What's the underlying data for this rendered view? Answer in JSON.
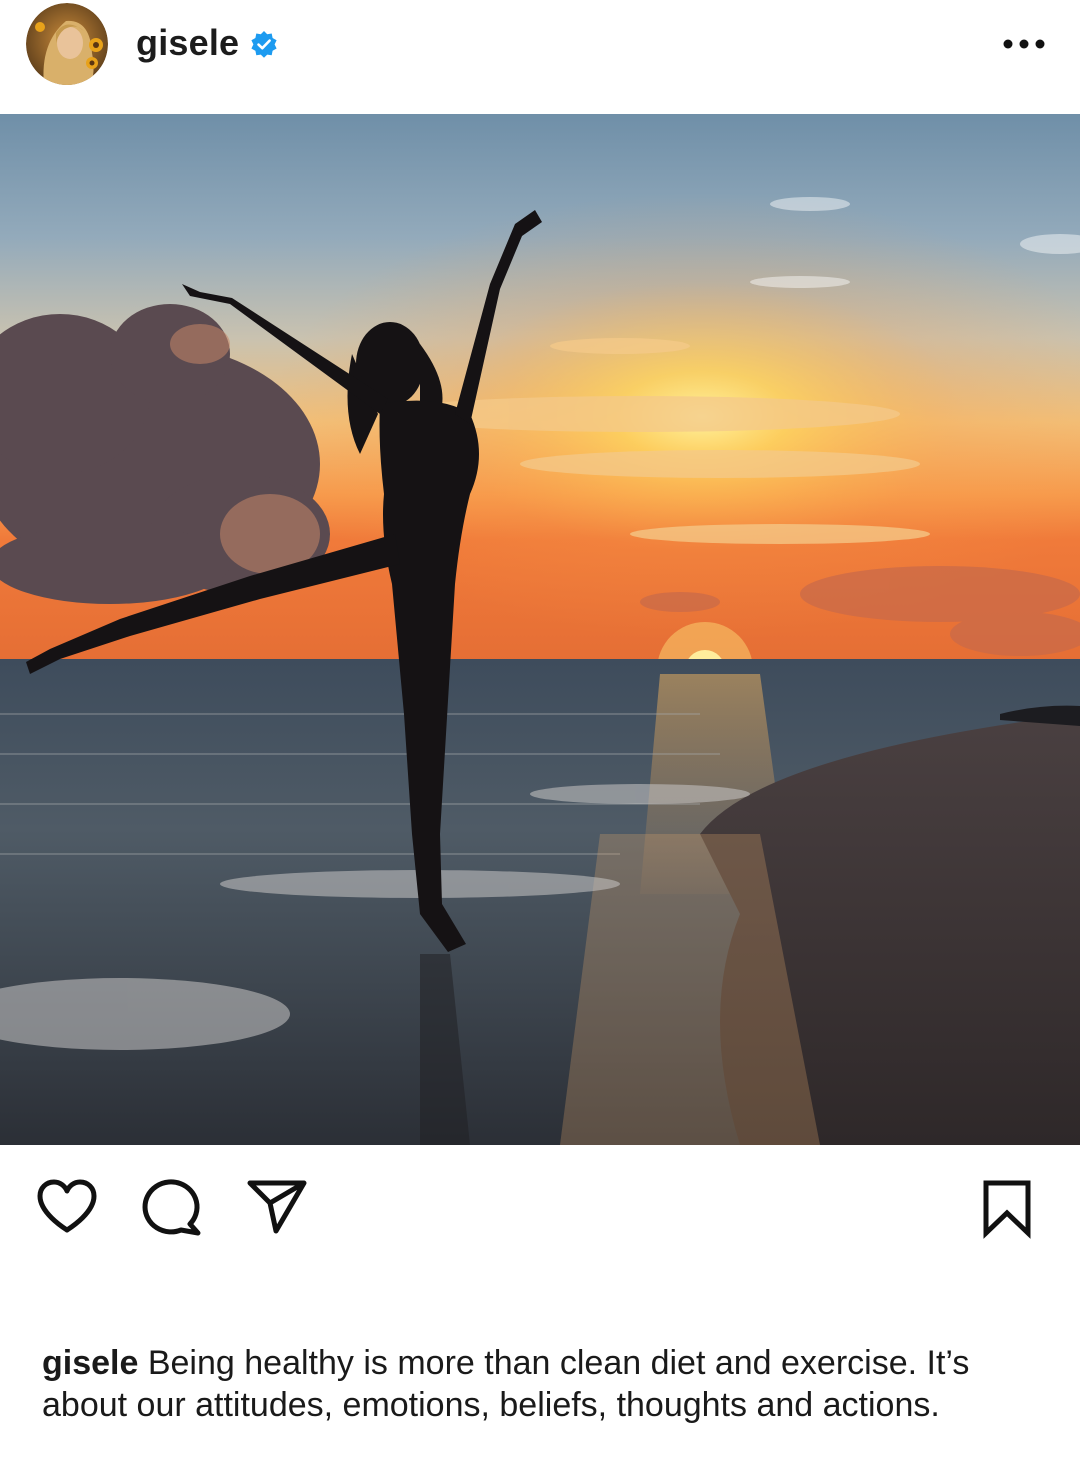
{
  "header": {
    "username": "gisele",
    "verified": true,
    "avatar_icon": "profile-photo-avatar",
    "more_icon": "more-options-icon"
  },
  "post": {
    "image_icon": "sunset-beach-photo"
  },
  "actions": {
    "like_icon": "heart-icon",
    "comment_icon": "comment-icon",
    "share_icon": "paper-plane-icon",
    "save_icon": "bookmark-icon"
  },
  "caption": {
    "username": "gisele",
    "text": "Being healthy is more than clean diet and exercise. It’s about our attitudes, emotions, beliefs, thoughts and actions."
  },
  "colors": {
    "verified_blue": "#1d9bf0",
    "icon": "#111111",
    "text": "#1a1a1a"
  }
}
